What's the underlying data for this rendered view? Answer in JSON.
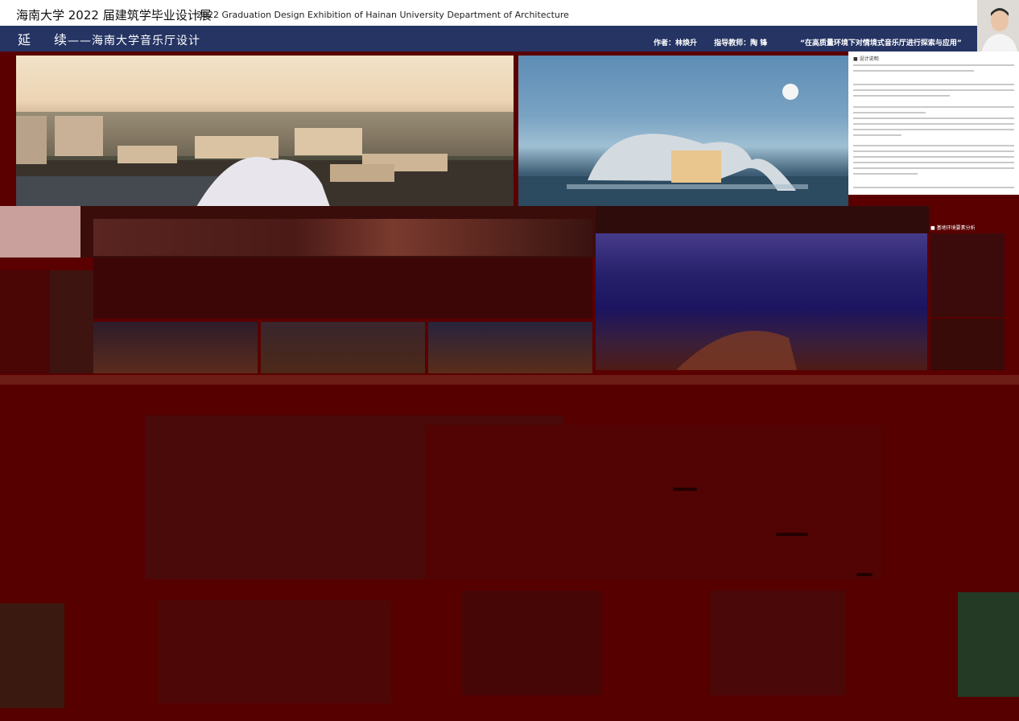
{
  "header": {
    "university_title": "海南大学 2022 届建筑学毕业设计展",
    "english_title": "2022 Graduation Design Exhibition of Hainan University Department of Architecture"
  },
  "project": {
    "title_char1": "延",
    "title_char2": "续",
    "subtitle": "——海南大学音乐厅设计",
    "author_label": "作者：林焕升",
    "advisor_label": "指导教师：陶  锋",
    "slogan": "“在高质量环境下对情境式音乐厅进行探索与应用”"
  },
  "description": {
    "heading": "■  设计说明"
  },
  "site_analysis": {
    "heading": "基地环境要素分析"
  },
  "colors": {
    "banner": "#253463",
    "background": "#560000"
  }
}
